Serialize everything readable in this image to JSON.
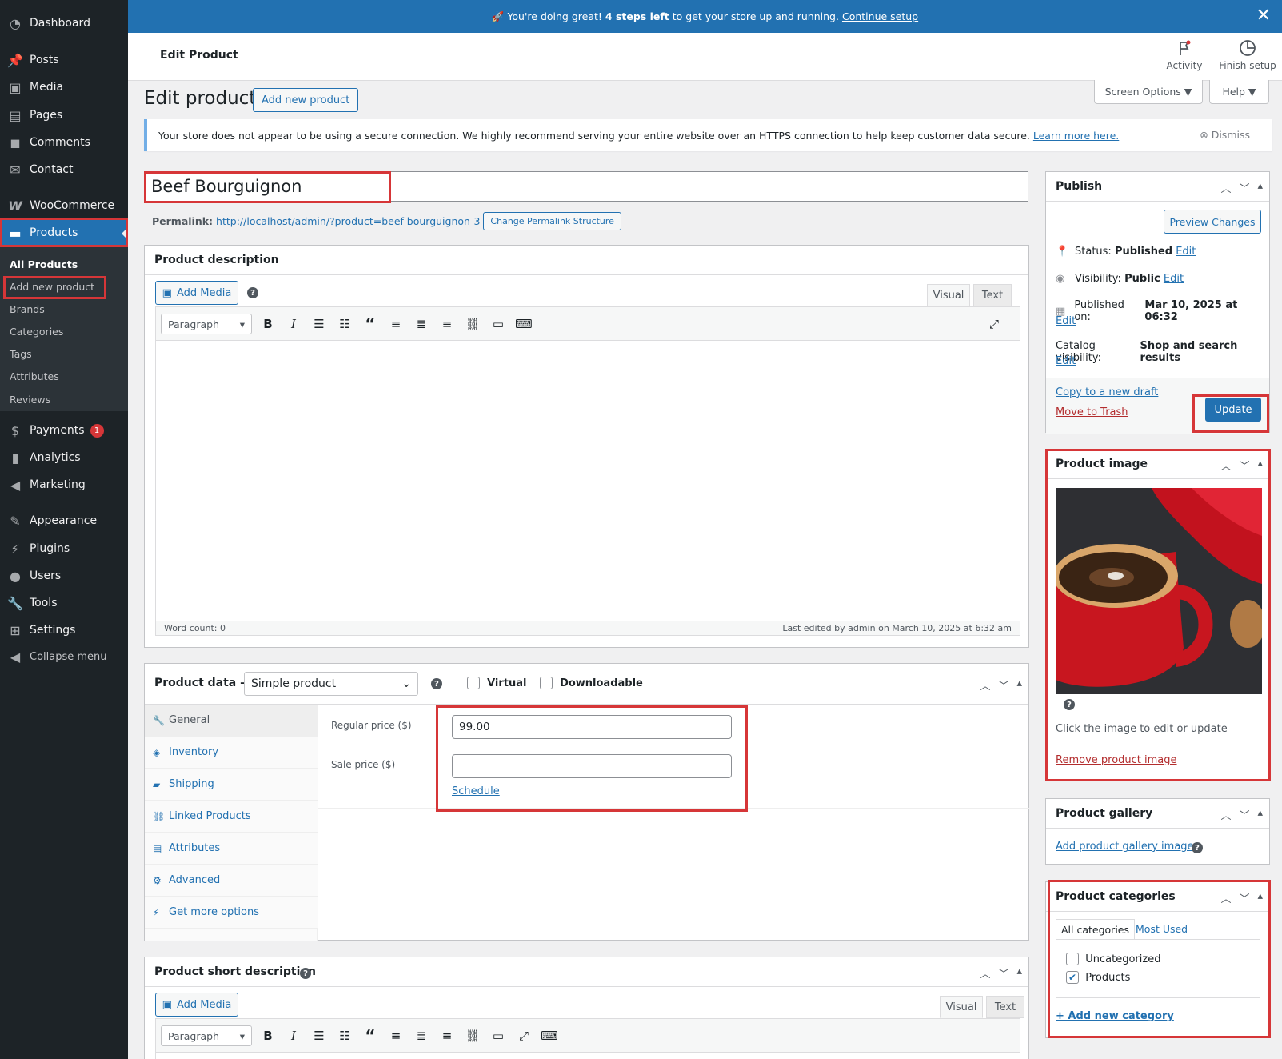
{
  "sidebar": {
    "items": [
      {
        "label": "Dashboard",
        "icon": "dashboard-icon"
      },
      {
        "label": "Posts",
        "icon": "pin-icon"
      },
      {
        "label": "Media",
        "icon": "media-icon"
      },
      {
        "label": "Pages",
        "icon": "pages-icon"
      },
      {
        "label": "Comments",
        "icon": "comment-icon"
      },
      {
        "label": "Contact",
        "icon": "mail-icon"
      },
      {
        "label": "WooCommerce",
        "icon": "woo-icon"
      },
      {
        "label": "Products",
        "icon": "archive-icon"
      },
      {
        "label": "Payments",
        "icon": "dollar-icon",
        "badge": "1"
      },
      {
        "label": "Analytics",
        "icon": "chart-icon"
      },
      {
        "label": "Marketing",
        "icon": "megaphone-icon"
      },
      {
        "label": "Appearance",
        "icon": "brush-icon"
      },
      {
        "label": "Plugins",
        "icon": "plug-icon"
      },
      {
        "label": "Users",
        "icon": "user-icon"
      },
      {
        "label": "Tools",
        "icon": "wrench-icon"
      },
      {
        "label": "Settings",
        "icon": "settings-icon"
      },
      {
        "label": "Collapse menu",
        "icon": "collapse-icon"
      }
    ],
    "submenu": [
      "All Products",
      "Add new product",
      "Brands",
      "Categories",
      "Tags",
      "Attributes",
      "Reviews"
    ]
  },
  "banner": {
    "emoji": "🚀",
    "prefix": "You're doing great!",
    "bold": "4 steps left",
    "suffix": "to get your store up and running.",
    "link": "Continue setup"
  },
  "header": {
    "title": "Edit Product",
    "activity": "Activity",
    "finish_setup": "Finish setup",
    "screen_options": "Screen Options ▼",
    "help": "Help ▼"
  },
  "page": {
    "heading": "Edit product",
    "add_new": "Add new product"
  },
  "notice": {
    "text": "Your store does not appear to be using a secure connection. We highly recommend serving your entire website over an HTTPS connection to help keep customer data secure.",
    "link": "Learn more here.",
    "dismiss": "Dismiss"
  },
  "product": {
    "title": "Beef Bourguignon",
    "permalink_label": "Permalink:",
    "permalink_url": "http://localhost/admin/?product=beef-bourguignon-3",
    "permalink_btn": "Change Permalink Structure"
  },
  "description": {
    "title": "Product description",
    "add_media": "Add Media",
    "tab_visual": "Visual",
    "tab_text": "Text",
    "format": "Paragraph",
    "word_count": "Word count: 0",
    "last_edited": "Last edited by admin on March 10, 2025 at 6:32 am"
  },
  "product_data": {
    "title": "Product data —",
    "type": "Simple product",
    "virtual": "Virtual",
    "downloadable": "Downloadable",
    "tabs": [
      "General",
      "Inventory",
      "Shipping",
      "Linked Products",
      "Attributes",
      "Advanced",
      "Get more options"
    ],
    "regular_price_label": "Regular price ($)",
    "regular_price": "99.00",
    "sale_price_label": "Sale price ($)",
    "sale_price": "",
    "schedule": "Schedule"
  },
  "short_description": {
    "title": "Product short description",
    "add_media": "Add Media",
    "tab_visual": "Visual",
    "tab_text": "Text",
    "format": "Paragraph"
  },
  "publish": {
    "title": "Publish",
    "preview": "Preview Changes",
    "status_label": "Status:",
    "status_value": "Published",
    "visibility_label": "Visibility:",
    "visibility_value": "Public",
    "published_label": "Published on:",
    "published_value": "Mar 10, 2025 at 06:32",
    "catalog_label": "Catalog visibility:",
    "catalog_value": "Shop and search results",
    "edit": "Edit",
    "copy_draft": "Copy to a new draft",
    "trash": "Move to Trash",
    "update": "Update"
  },
  "product_image": {
    "title": "Product image",
    "hint": "Click the image to edit or update",
    "remove": "Remove product image"
  },
  "gallery": {
    "title": "Product gallery",
    "add": "Add product gallery images"
  },
  "categories": {
    "title": "Product categories",
    "tab_all": "All categories",
    "tab_most": "Most Used",
    "items": [
      {
        "label": "Uncategorized",
        "checked": false
      },
      {
        "label": "Products",
        "checked": true
      }
    ],
    "add_new": "+ Add new category"
  },
  "colors": {
    "accent": "#2271b1",
    "sidebar": "#1d2327",
    "highlight": "#d63638"
  }
}
